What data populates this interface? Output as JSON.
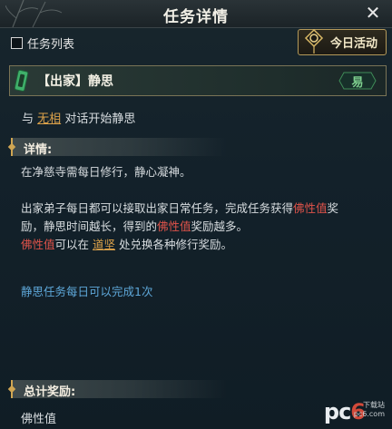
{
  "window": {
    "title": "任务详情",
    "close_icon": "close-icon"
  },
  "task_list_toggle": {
    "label": "任务列表",
    "checked": false
  },
  "today_button": {
    "label": "今日活动",
    "icon": "lantern-icon"
  },
  "task": {
    "name": "【出家】静思",
    "difficulty": "易",
    "objective_prefix": "与",
    "objective_npc": "无相",
    "objective_suffix": "对话开始静思"
  },
  "details": {
    "header": "详情:",
    "line1": "在净慈寺需每日修行，静心凝神。",
    "p2_a": "出家弟子每日都可以接取出家日常任务，完成任务获得",
    "p2_b": "佛性值",
    "p2_c": "奖",
    "p3_a": "励，静思时间越长，得到的",
    "p3_b": "佛性值",
    "p3_c": "奖励越多。",
    "p4_a": "佛性值",
    "p4_b": "可以在",
    "p4_c": "道坚",
    "p4_d": "处兑换各种修行奖励。",
    "note": "静思任务每日可以完成1次"
  },
  "rewards": {
    "header": "总计奖励:",
    "item": "佛性值"
  },
  "watermark": {
    "text_pc": "pc",
    "text_6": "6",
    "sub1": "下载站",
    "sub2": "pc6.com"
  },
  "colors": {
    "accent_gold": "#d0a653",
    "highlight_red": "#e0534a",
    "note_blue": "#5ea7d9",
    "difficulty_green": "#7fd18f"
  }
}
